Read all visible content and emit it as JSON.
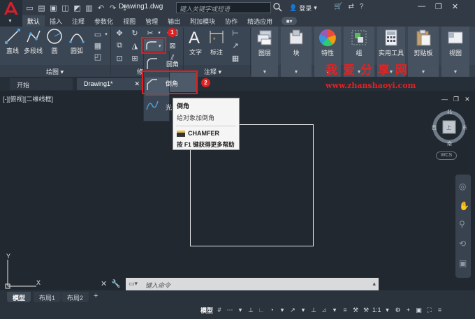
{
  "title_bar": {
    "document_title": "Drawing1.dwg",
    "search_placeholder": "键入关键字或短语",
    "login_label": "登录"
  },
  "ribbon_tabs": [
    "默认",
    "插入",
    "注释",
    "参数化",
    "视图",
    "管理",
    "输出",
    "附加模块",
    "协作",
    "精选应用"
  ],
  "ribbon": {
    "draw_tools": [
      "直线",
      "多段线",
      "圆",
      "圆弧"
    ],
    "draw_panel_title": "绘图",
    "modify_panel_title": "修",
    "text_label": "文字",
    "dimension_label": "标注",
    "annotation_panel_title": "注释",
    "right_buttons": [
      "图层",
      "块",
      "特性",
      "组",
      "实用工具",
      "剪贴板",
      "视图"
    ]
  },
  "dropdown": {
    "items": [
      "圆角",
      "倒角",
      "光"
    ]
  },
  "tooltip": {
    "title": "倒角",
    "description": "给对象加倒角",
    "command": "CHAMFER",
    "help": "按 F1 键获得更多帮助"
  },
  "doc_tabs": [
    "开始",
    "Drawing1*"
  ],
  "viewport_label": "[-][俯视][二维线框]",
  "viewcube": {
    "north": "北",
    "south": "南",
    "west": "西",
    "east": "东",
    "top": "上",
    "wcs": "WCS"
  },
  "ucs": {
    "x": "X",
    "y": "Y"
  },
  "command_line": {
    "placeholder": "键入命令"
  },
  "layout_tabs": [
    "模型",
    "布局1",
    "布局2"
  ],
  "status_bar": {
    "model": "模型",
    "scale": "1:1"
  },
  "annotations": {
    "badge1": "1",
    "badge2": "2"
  },
  "watermark": {
    "line1": "我爱分享网",
    "line2": "www.zhanshaoyi.com"
  },
  "colors": {
    "accent_red": "#e02020",
    "ribbon_bg": "#3b4654",
    "canvas_bg": "#212830",
    "status_blue": "#5aa7e8"
  }
}
